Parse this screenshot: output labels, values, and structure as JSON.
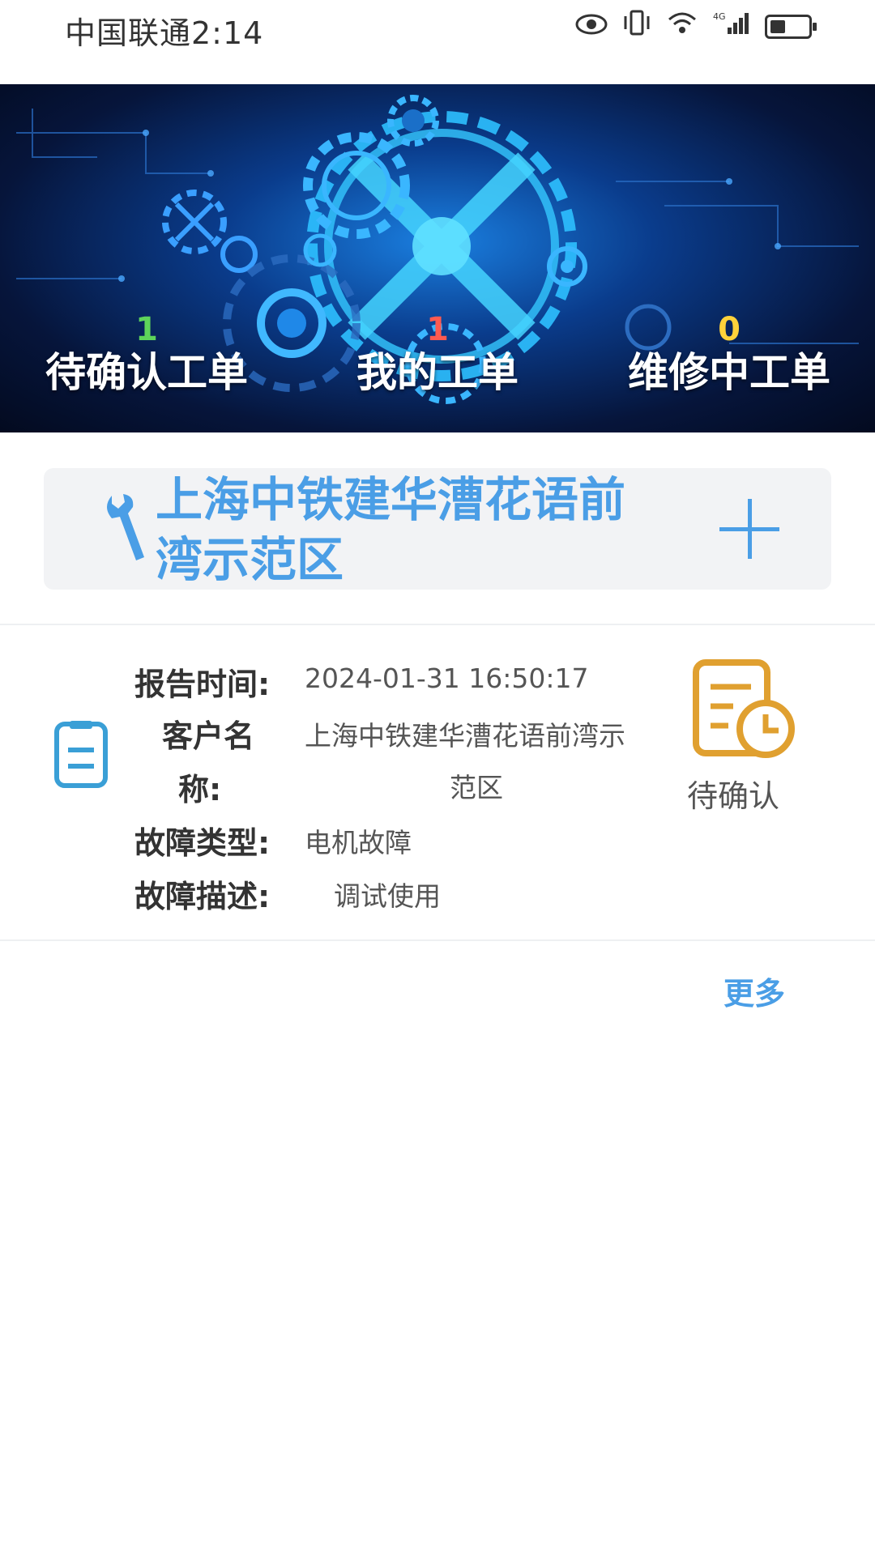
{
  "status_bar": {
    "carrier_time": "中国联通2:14",
    "network_label": "4G"
  },
  "banner": {
    "stats": [
      {
        "count": "1",
        "label": "待确认工单",
        "color": "#5ed45a"
      },
      {
        "count": "1",
        "label": "我的工单",
        "color": "#ff5a50"
      },
      {
        "count": "0",
        "label": "维修中工单",
        "color": "#ffd23a"
      }
    ]
  },
  "project": {
    "title": "上海中铁建华漕花语前湾示范区"
  },
  "ticket": {
    "report_time_label": "报告时间:",
    "report_time_value": "2024-01-31 16:50:17",
    "customer_label_line1": "客户名",
    "customer_label_line2": "称:",
    "customer_value_line1": "上海中铁建华漕花语前湾示",
    "customer_value_line2": "范区",
    "fault_type_label": "故障类型:",
    "fault_type_value": "电机故障",
    "fault_desc_label": "故障描述:",
    "fault_desc_value": "调试使用",
    "status": "待确认"
  },
  "more_label": "更多",
  "colors": {
    "accent": "#4a9ee6",
    "status_icon": "#e0a030"
  }
}
